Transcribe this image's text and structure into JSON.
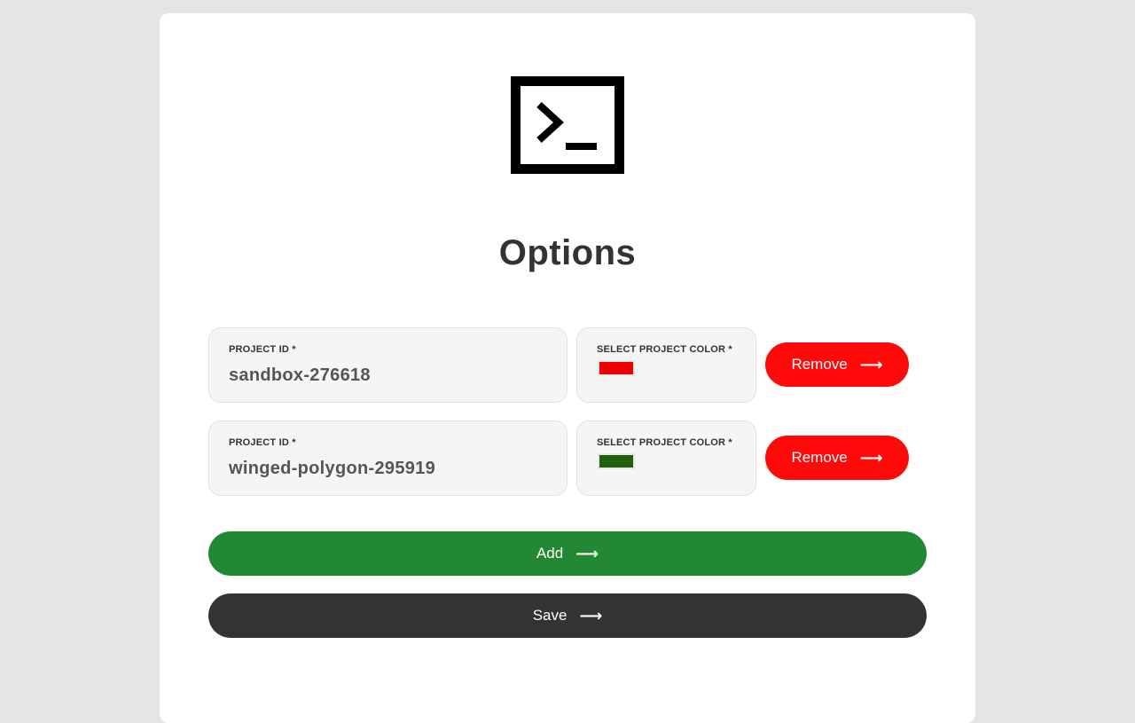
{
  "page": {
    "title": "Options"
  },
  "projects": [
    {
      "id_label": "PROJECT ID *",
      "id_value": "sandbox-276618",
      "color_label": "SELECT PROJECT COLOR *",
      "color": "#ee0000",
      "remove_label": "Remove"
    },
    {
      "id_label": "PROJECT ID *",
      "id_value": "winged-polygon-295919",
      "color_label": "SELECT PROJECT COLOR *",
      "color": "#1f5e0a",
      "remove_label": "Remove"
    }
  ],
  "actions": {
    "add_label": "Add",
    "save_label": "Save",
    "arrow": "⟶"
  },
  "icons": {
    "logo": "terminal-icon",
    "button_arrow": "arrow-right-icon"
  },
  "colors": {
    "remove": "#ff0a0a",
    "add": "#228833",
    "save": "#333333"
  }
}
